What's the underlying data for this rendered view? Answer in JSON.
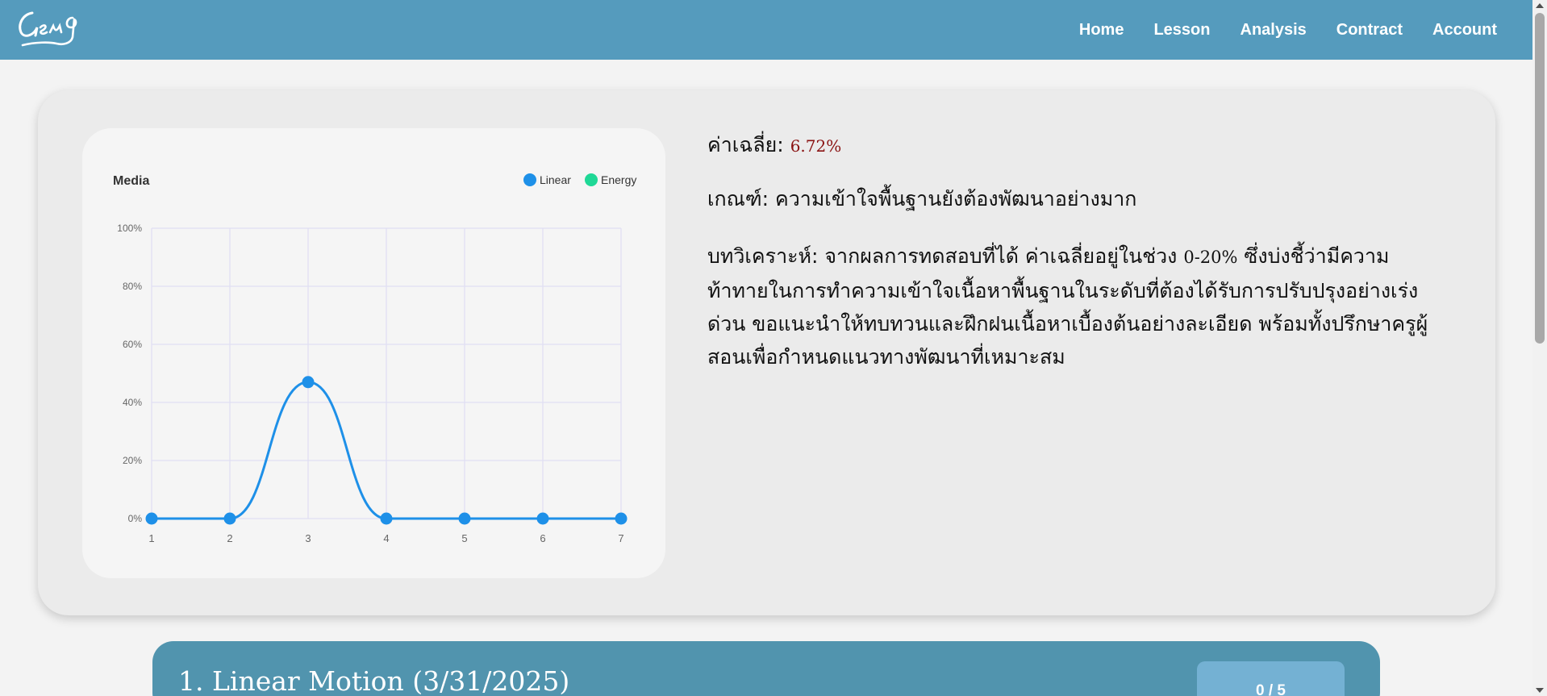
{
  "header": {
    "logo_text": "Gen g",
    "nav": [
      "Home",
      "Lesson",
      "Analysis",
      "Contract",
      "Account"
    ]
  },
  "summary": {
    "avg_label": "ค่าเฉลี่ย:",
    "avg_value": "6.72%",
    "criteria_label": "เกณฑ์:",
    "criteria_text": "ความเข้าใจพื้นฐานยังต้องพัฒนาอย่างมาก",
    "analysis_label": "บทวิเคราะห์:",
    "analysis_text_1": "จากผลการทดสอบที่ได้ ค่าเฉลี่ยอยู่ในช่วง",
    "analysis_range": "0-20%",
    "analysis_text_2": "ซึ่งบ่งชี้ว่ามีความท้าทายในการทำความเข้าใจเนื้อหาพื้นฐานในระดับที่ต้องได้รับการปรับปรุงอย่างเร่งด่วน ขอแนะนำให้ทบทวนและฝึกฝนเนื้อหาเบื้องต้นอย่างละเอียด พร้อมทั้งปรึกษาครูผู้สอนเพื่อกำหนดแนวทางพัฒนาที่เหมาะสม"
  },
  "chart_data": {
    "type": "line",
    "title": "Media",
    "x": [
      1,
      2,
      3,
      4,
      5,
      6,
      7
    ],
    "series": [
      {
        "name": "Linear",
        "color": "#1e90e8",
        "values": [
          0,
          0,
          47,
          0,
          0,
          0,
          0
        ]
      },
      {
        "name": "Energy",
        "color": "#1fd896",
        "values": []
      }
    ],
    "yticks": [
      "0%",
      "20%",
      "40%",
      "60%",
      "80%",
      "100%"
    ],
    "ylim": [
      0,
      100
    ],
    "grid": true,
    "legend": "top-right"
  },
  "lesson": {
    "title": "1. Linear Motion (3/31/2025)",
    "score": "0 / 5"
  }
}
